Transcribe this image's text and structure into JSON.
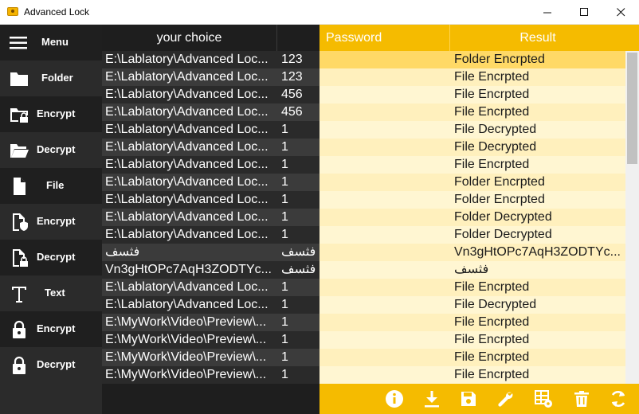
{
  "window": {
    "title": "Advanced Lock",
    "minimize": "—",
    "maximize": "☐",
    "close": "✕"
  },
  "sidebar": {
    "menu": "Menu",
    "folder": "Folder",
    "folder_encrypt": "Encrypt",
    "folder_decrypt": "Decrypt",
    "file": "File",
    "file_encrypt": "Encrypt",
    "file_decrypt": "Decrypt",
    "text": "Text",
    "text_encrypt": "Encrypt",
    "text_decrypt": "Decrypt"
  },
  "grid": {
    "headers": {
      "choice": "your choice",
      "password": "Password",
      "result": "Result"
    },
    "rows": [
      {
        "choice": "E:\\Lablatory\\Advanced Loc...",
        "pw": "123",
        "result": "Folder Encrpted",
        "selected": true
      },
      {
        "choice": "E:\\Lablatory\\Advanced Loc...",
        "pw": "123",
        "result": "File Encrpted"
      },
      {
        "choice": "E:\\Lablatory\\Advanced Loc...",
        "pw": "456",
        "result": "File Encrpted"
      },
      {
        "choice": "E:\\Lablatory\\Advanced Loc...",
        "pw": "456",
        "result": "File Encrpted"
      },
      {
        "choice": "E:\\Lablatory\\Advanced Loc...",
        "pw": "1",
        "result": "File Decrypted"
      },
      {
        "choice": "E:\\Lablatory\\Advanced Loc...",
        "pw": "1",
        "result": "File Decrypted"
      },
      {
        "choice": "E:\\Lablatory\\Advanced Loc...",
        "pw": "1",
        "result": "File Encrpted"
      },
      {
        "choice": "E:\\Lablatory\\Advanced Loc...",
        "pw": "1",
        "result": "Folder Encrpted"
      },
      {
        "choice": "E:\\Lablatory\\Advanced Loc...",
        "pw": "1",
        "result": "Folder Encrpted"
      },
      {
        "choice": "E:\\Lablatory\\Advanced Loc...",
        "pw": "1",
        "result": "Folder Decrypted"
      },
      {
        "choice": "E:\\Lablatory\\Advanced Loc...",
        "pw": "1",
        "result": "Folder Decrypted"
      },
      {
        "choice": "فثسف",
        "pw": "فثسف",
        "result": "Vn3gHtOPc7AqH3ZODTYc...",
        "rtl": true
      },
      {
        "choice": "Vn3gHtOPc7AqH3ZODTYc...",
        "pw": "فثسف",
        "result": "فثسف",
        "rtl_result": true
      },
      {
        "choice": "E:\\Lablatory\\Advanced Loc...",
        "pw": "1",
        "result": "File Encrpted"
      },
      {
        "choice": "E:\\Lablatory\\Advanced Loc...",
        "pw": "1",
        "result": "File Decrypted"
      },
      {
        "choice": "E:\\MyWork\\Video\\Preview\\...",
        "pw": "1",
        "result": "File Encrpted"
      },
      {
        "choice": "E:\\MyWork\\Video\\Preview\\...",
        "pw": "1",
        "result": "File Encrpted"
      },
      {
        "choice": "E:\\MyWork\\Video\\Preview\\...",
        "pw": "1",
        "result": "File Encrpted"
      },
      {
        "choice": "E:\\MyWork\\Video\\Preview\\...",
        "pw": "1",
        "result": "File Encrpted"
      }
    ]
  },
  "toolbar": {
    "icons": [
      "info-icon",
      "download-icon",
      "save-icon",
      "wrench-icon",
      "grid-settings-icon",
      "delete-icon",
      "refresh-icon"
    ]
  },
  "colors": {
    "accent": "#f5bb00",
    "sidebar": "#2b2b2b",
    "grid_dark": "#2a2a2a"
  }
}
